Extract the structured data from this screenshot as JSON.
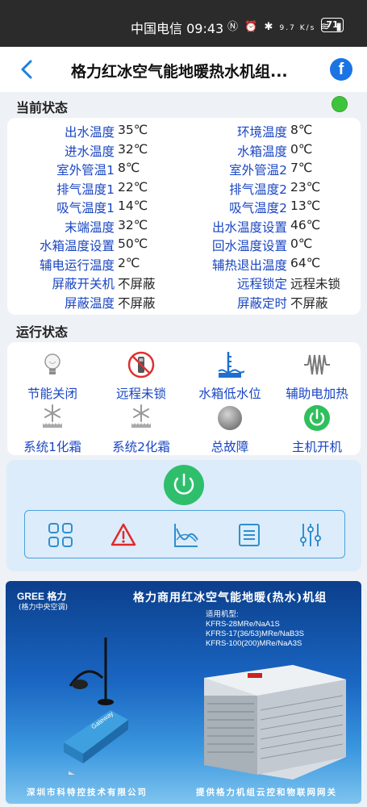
{
  "status_bar": {
    "carrier_time": "中国电信 09:43",
    "net_speed": "9.7 K/s",
    "battery": "71"
  },
  "header": {
    "title": "格力红冰空气能地暖热水机组...",
    "back_icon": "chevron-left-icon",
    "share_icon": "facebook-icon"
  },
  "current_status": {
    "title": "当前状态",
    "indicator_color": "#3ec43a",
    "rows": [
      {
        "label1": "出水温度",
        "value1": "35℃",
        "label2": "环境温度",
        "value2": "8℃"
      },
      {
        "label1": "进水温度",
        "value1": "32℃",
        "label2": "水箱温度",
        "value2": "0℃"
      },
      {
        "label1": "室外管温1",
        "value1": "8℃",
        "label2": "室外管温2",
        "value2": "7℃"
      },
      {
        "label1": "排气温度1",
        "value1": "22℃",
        "label2": "排气温度2",
        "value2": "23℃"
      },
      {
        "label1": "吸气温度1",
        "value1": "14℃",
        "label2": "吸气温度2",
        "value2": "13℃"
      },
      {
        "label1": "末端温度",
        "value1": "32℃",
        "label2": "出水温度设置",
        "value2": "46℃"
      },
      {
        "label1": "水箱温度设置",
        "value1": "50℃",
        "label2": "回水温度设置",
        "value2": "0℃"
      },
      {
        "label1": "辅电运行温度",
        "value1": "2℃",
        "label2": "辅热退出温度",
        "value2": "64℃"
      },
      {
        "label1": "屏蔽开关机",
        "value1": "不屏蔽",
        "label2": "远程锁定",
        "value2": "远程未锁"
      },
      {
        "label1": "屏蔽温度",
        "value1": "不屏蔽",
        "label2": "屏蔽定时",
        "value2": "不屏蔽"
      }
    ]
  },
  "run_status": {
    "title": "运行状态",
    "items": [
      {
        "label": "节能关闭",
        "icon": "lightbulb-icon"
      },
      {
        "label": "远程未锁",
        "icon": "remote-unlocked-icon"
      },
      {
        "label": "水箱低水位",
        "icon": "water-level-low-icon"
      },
      {
        "label": "辅助电加热",
        "icon": "electric-heater-icon"
      },
      {
        "label": "系统1化霜",
        "icon": "defrost-icon"
      },
      {
        "label": "系统2化霜",
        "icon": "defrost-icon"
      },
      {
        "label": "总故障",
        "icon": "fault-indicator-icon"
      },
      {
        "label": "主机开机",
        "icon": "power-on-icon"
      }
    ]
  },
  "controls": {
    "power_color": "#2fbf6c",
    "toolbar": [
      {
        "name": "menu-grid-icon"
      },
      {
        "name": "alarm-warning-icon"
      },
      {
        "name": "curve-chart-icon"
      },
      {
        "name": "document-list-icon"
      },
      {
        "name": "settings-sliders-icon"
      }
    ]
  },
  "banner": {
    "brand": "GREE 格力",
    "brand_sub": "(格力中央空调)",
    "title": "格力商用红冰空气能地暖(热水)机组",
    "models_label": "适用机型:",
    "models": [
      "KFRS-28MRe/NaA1S",
      "KFRS-17(36/53)MRe/NaB3S",
      "KFRS-100(200)MRe/NaA3S"
    ],
    "device_label": "Gateway",
    "footer_left": "深圳市科特控技术有限公司",
    "footer_right": "提供格力机组云控和物联网网关"
  }
}
